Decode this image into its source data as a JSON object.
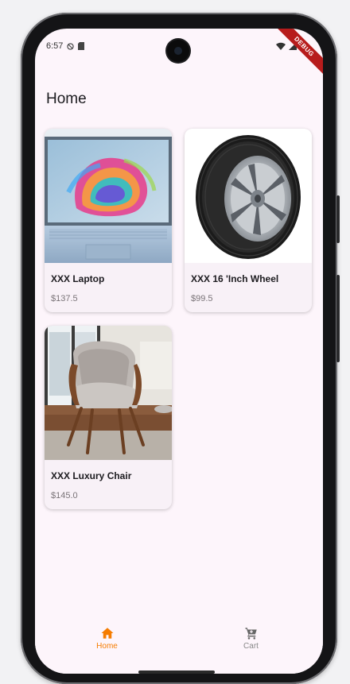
{
  "status_bar": {
    "time": "6:57"
  },
  "debug_banner": "DEBUG",
  "app_bar": {
    "title": "Home"
  },
  "products": [
    {
      "name": "XXX Laptop",
      "price": "$137.5"
    },
    {
      "name": "XXX 16 'Inch Wheel",
      "price": "$99.5"
    },
    {
      "name": "XXX Luxury Chair",
      "price": "$145.0"
    }
  ],
  "bottom_nav": {
    "items": [
      {
        "label": "Home",
        "icon": "home-icon",
        "active": true
      },
      {
        "label": "Cart",
        "icon": "cart-icon",
        "active": false
      }
    ]
  },
  "colors": {
    "accent": "#f57c00",
    "background": "#fdf5fb",
    "card": "#f8f1f7"
  }
}
